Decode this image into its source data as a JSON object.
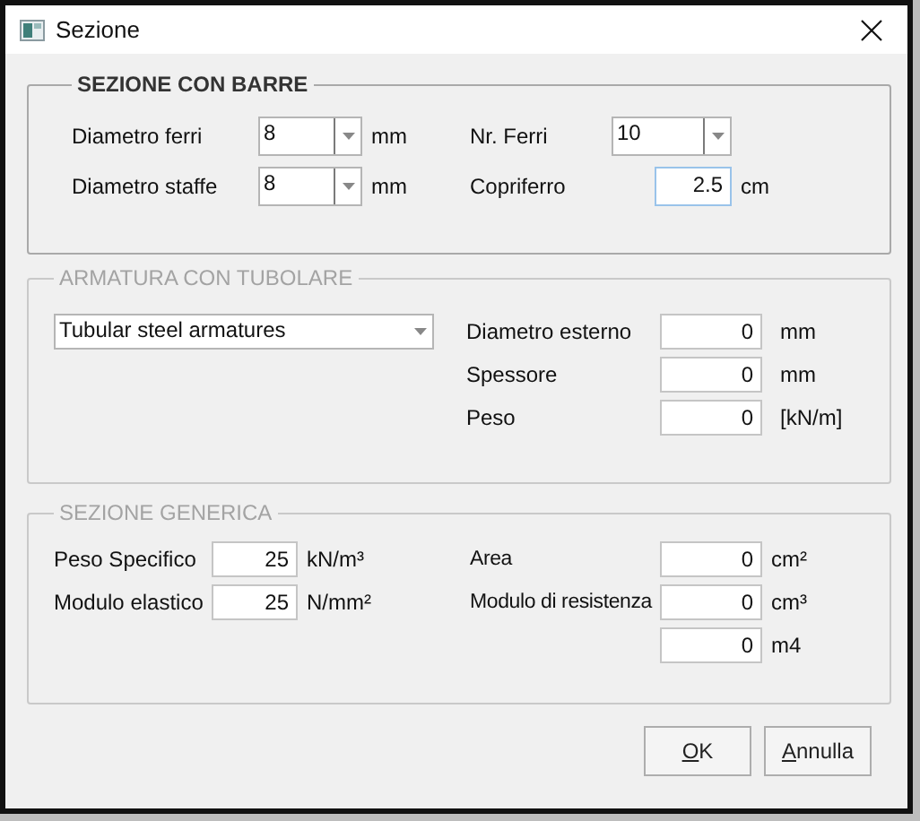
{
  "window": {
    "title": "Sezione"
  },
  "groups": [
    {
      "title": "SEZIONE CON BARRE",
      "disabled": false,
      "columns": [
        [
          {
            "label": "Diametro ferri",
            "kind": "combo",
            "value": "8",
            "unit": "mm"
          },
          {
            "label": "Diametro staffe",
            "kind": "combo",
            "value": "8",
            "unit": "mm"
          }
        ],
        [
          {
            "label": "Nr. Ferri",
            "kind": "combo",
            "value": "10"
          },
          {
            "label": "Copriferro",
            "kind": "text",
            "value": "2.5",
            "unit": "cm",
            "focused": true
          }
        ]
      ]
    },
    {
      "title": "ARMATURA CON TUBOLARE",
      "disabled": true,
      "columns": [
        [
          {
            "kind": "combo",
            "value": "Tubular steel armatures"
          }
        ],
        [
          {
            "label": "Diametro esterno",
            "kind": "text",
            "value": "0",
            "unit": "mm"
          },
          {
            "label": "Spessore",
            "kind": "text",
            "value": "0",
            "unit": "mm"
          },
          {
            "label": "Peso",
            "kind": "text",
            "value": "0",
            "unit": "[kN/m]"
          }
        ]
      ]
    },
    {
      "title": "SEZIONE GENERICA",
      "disabled": true,
      "columns": [
        [
          {
            "label": "Peso Specifico",
            "kind": "text",
            "value": "25",
            "unit": "kN/m³"
          },
          {
            "label": "Modulo elastico",
            "kind": "text",
            "value": "25",
            "unit": "N/mm²"
          }
        ],
        [
          {
            "label": "Area",
            "kind": "text",
            "value": "0",
            "unit": "cm²"
          },
          {
            "label": "Modulo di resistenza",
            "kind": "text",
            "value": "0",
            "unit": "cm³"
          },
          {
            "kind": "text",
            "value": "0",
            "unit": "m4"
          }
        ]
      ]
    }
  ],
  "buttons": [
    "OK",
    "Annulla"
  ]
}
